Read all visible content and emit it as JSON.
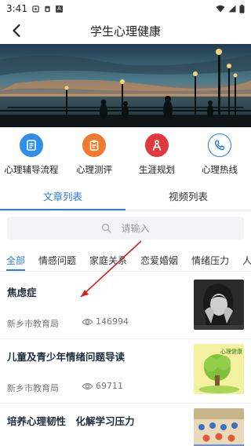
{
  "status": {
    "time": "3:41",
    "notif_letter": "A"
  },
  "header": {
    "title": "学生心理健康"
  },
  "quick": [
    {
      "label": "心理辅导流程",
      "icon": "document-icon",
      "color": "#2f8fe6"
    },
    {
      "label": "心理测评",
      "icon": "clipboard-icon",
      "color": "#f07a2e"
    },
    {
      "label": "生涯规划",
      "icon": "compass-icon",
      "color": "#e0393e"
    },
    {
      "label": "心理热线",
      "icon": "phone-icon",
      "color": "#2a7de1"
    }
  ],
  "tabs": [
    {
      "label": "文章列表",
      "active": true
    },
    {
      "label": "视频列表",
      "active": false
    }
  ],
  "search": {
    "placeholder": "请输入"
  },
  "categories": [
    {
      "label": "全部",
      "active": true
    },
    {
      "label": "情感问题"
    },
    {
      "label": "家庭关系"
    },
    {
      "label": "恋爱婚姻"
    },
    {
      "label": "情绪压力"
    },
    {
      "label": "人"
    }
  ],
  "articles": [
    {
      "title": "焦虑症",
      "source": "新乡市教育局",
      "views": "146994",
      "thumb": "distressed-woman-photo"
    },
    {
      "title": "儿童及青少年情绪问题导读",
      "source": "新乡市教育局",
      "views": "69711",
      "thumb": "tree-illustration",
      "thumb_text": "心理健康"
    },
    {
      "title": "培养心理韧性　化解学习压力",
      "thumb": "classroom-photo"
    }
  ],
  "colors": {
    "accent": "#2a7de1",
    "annotation": "#d32020"
  }
}
